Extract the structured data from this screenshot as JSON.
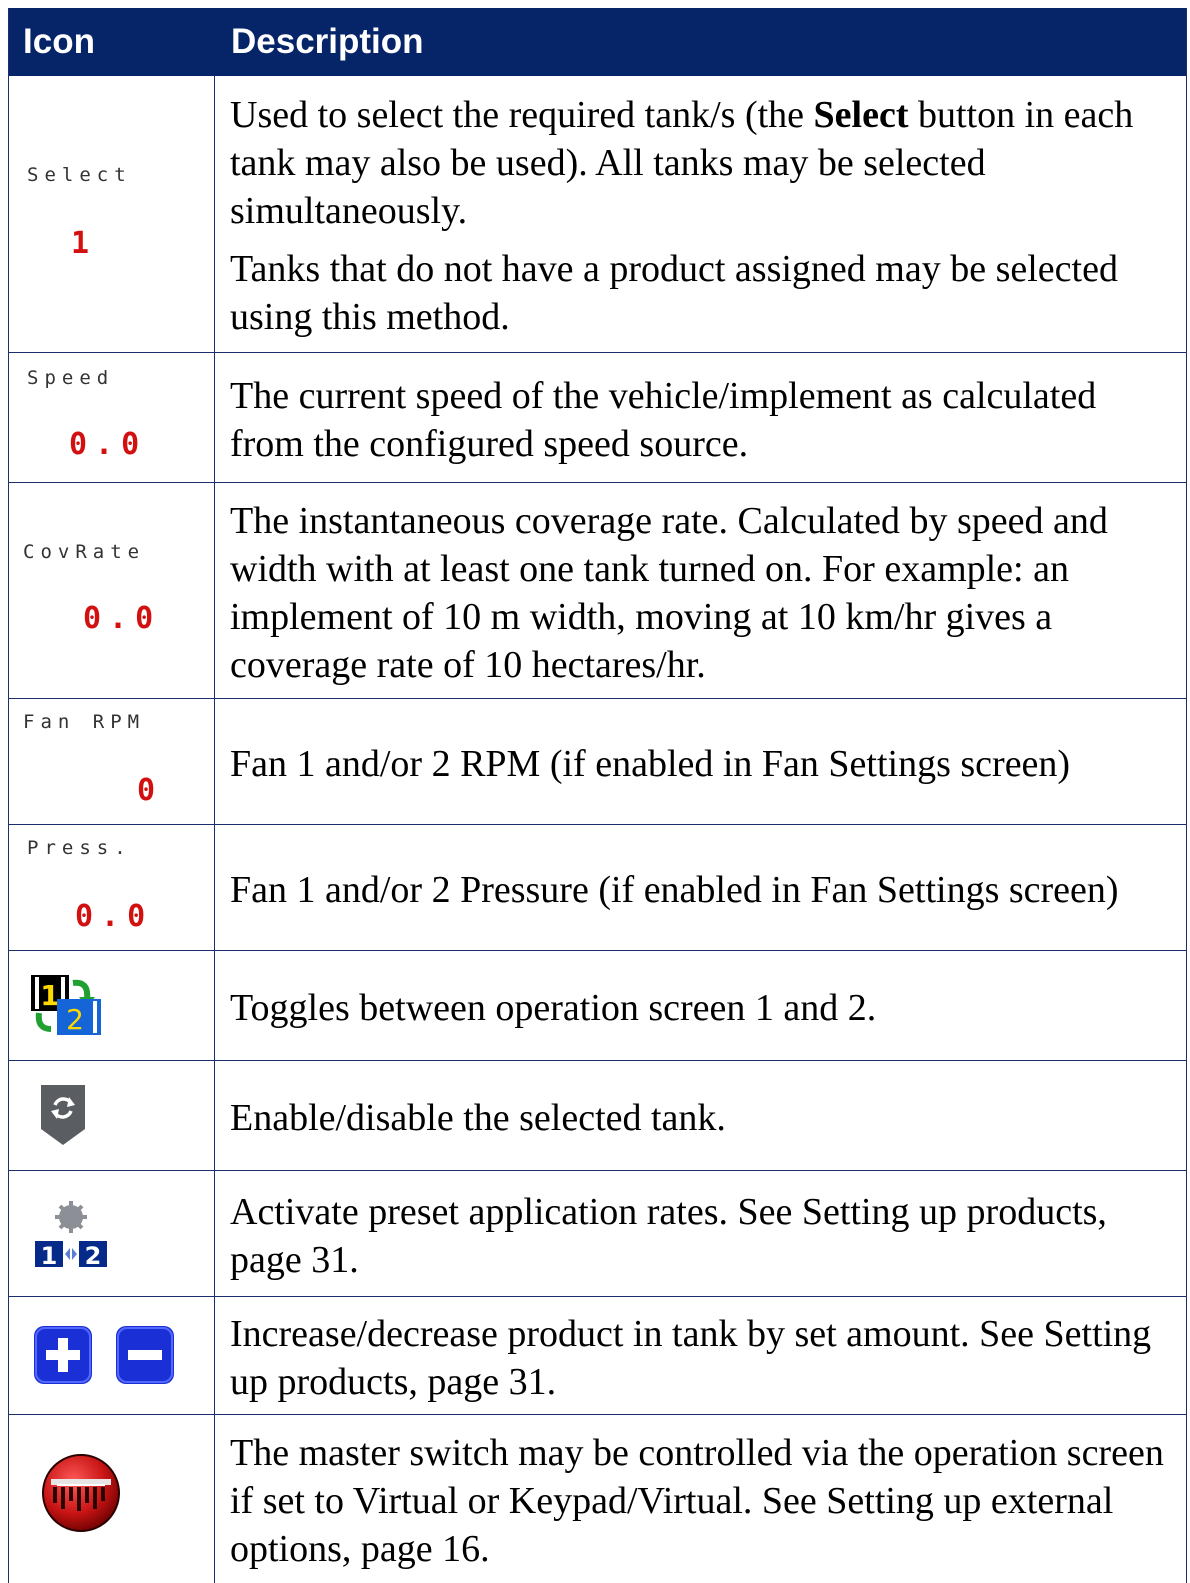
{
  "header": {
    "icon_col": "Icon",
    "desc_col": "Description"
  },
  "rows": [
    {
      "widget_label": "Select",
      "widget_value": "1",
      "desc_parts": [
        "Used to select the required tank/s (the ",
        "Select",
        " button in each tank may also be used). All tanks may be selected simultaneously."
      ],
      "desc_p2": "Tanks that do not have a product assigned may be selected using this method."
    },
    {
      "widget_label": "Speed",
      "widget_value": "0.0",
      "desc": "The current speed of the vehicle/implement as calculated from the configured speed source."
    },
    {
      "widget_label": "CovRate",
      "widget_value": "0.0",
      "desc": "The instantaneous coverage rate. Calculated by speed and width with at least one tank turned on. For example: an implement of 10 m width, moving at 10 km/hr gives a coverage rate of 10 hectares/hr."
    },
    {
      "widget_label": "Fan RPM",
      "widget_value": "0",
      "desc": "Fan 1 and/or 2 RPM (if enabled in Fan Settings screen)"
    },
    {
      "widget_label": "Press.",
      "widget_value": "0.0",
      "desc": "Fan 1 and/or 2 Pressure (if enabled in Fan Settings screen)"
    },
    {
      "icon": "toggle-screen-icon",
      "icon_text_1": "1",
      "icon_text_2": "2",
      "desc": "Toggles between operation screen 1 and 2."
    },
    {
      "icon": "enable-tank-icon",
      "desc": "Enable/disable the selected tank."
    },
    {
      "icon": "preset-rates-icon",
      "icon_text_1": "1",
      "icon_text_2": "2",
      "desc": "Activate preset application rates. See Setting up products, page 31."
    },
    {
      "icon": "plus-minus-icons",
      "desc": "Increase/decrease product in tank by set amount. See Setting up products, page 31."
    },
    {
      "icon": "master-switch-icon",
      "desc": "The master switch may be controlled via the operation screen if set to Virtual or Keypad/Virtual. See Setting up external options, page 16."
    }
  ],
  "colors": {
    "header_bg": "#062568",
    "value_red": "#d31010",
    "border": "#1c2f6b"
  }
}
